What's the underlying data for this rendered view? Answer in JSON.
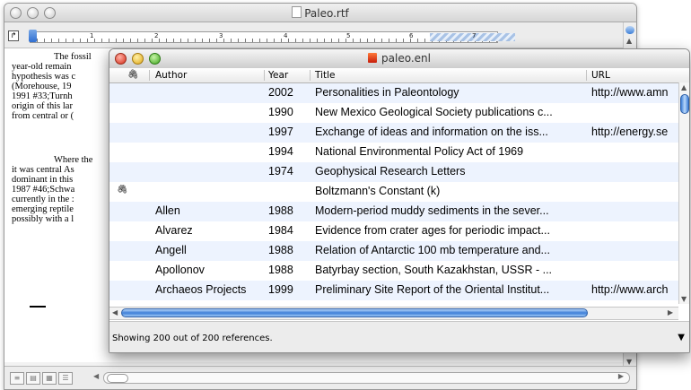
{
  "back_window": {
    "title": "Paleo.rtf",
    "ruler_numbers": [
      "1",
      "2",
      "3",
      "4",
      "5",
      "6",
      "7"
    ],
    "paragraph1": [
      "The fossil",
      "year-old remain",
      "hypothesis was c",
      "(Morehouse, 19",
      "1991 #33;Turnh",
      "origin of this lar",
      "from central or ("
    ],
    "paragraph2": [
      "Where the",
      "it was central As",
      "dominant in this",
      "1987 #46;Schwa",
      "currently in the :",
      "emerging reptile",
      "possibly with a l"
    ]
  },
  "front_window": {
    "title": "paleo.enl",
    "columns": {
      "clip": "🖇",
      "author": "Author",
      "year": "Year",
      "title": "Title",
      "url": "URL"
    },
    "rows": [
      {
        "clip": "",
        "author": "",
        "year": "2002",
        "title": "Personalities in Paleontology",
        "url": "http://www.amn"
      },
      {
        "clip": "",
        "author": "",
        "year": "1990",
        "title": "New Mexico Geological Society publications c...",
        "url": ""
      },
      {
        "clip": "",
        "author": "",
        "year": "1997",
        "title": "Exchange of ideas and information on the iss...",
        "url": "http://energy.se"
      },
      {
        "clip": "",
        "author": "",
        "year": "1994",
        "title": "National Environmental Policy Act of 1969",
        "url": ""
      },
      {
        "clip": "",
        "author": "",
        "year": "1974",
        "title": "Geophysical Research Letters",
        "url": ""
      },
      {
        "clip": "🖇",
        "author": "",
        "year": "",
        "title": "Boltzmann's Constant (k)",
        "url": ""
      },
      {
        "clip": "",
        "author": "Allen",
        "year": "1988",
        "title": "Modern-period muddy sediments in the sever...",
        "url": ""
      },
      {
        "clip": "",
        "author": "Alvarez",
        "year": "1984",
        "title": "Evidence from crater ages for periodic impact...",
        "url": ""
      },
      {
        "clip": "",
        "author": "Angell",
        "year": "1988",
        "title": "Relation of Antarctic 100 mb temperature and...",
        "url": ""
      },
      {
        "clip": "",
        "author": "Apollonov",
        "year": "1988",
        "title": "Batyrbay section, South Kazakhstan, USSR - ...",
        "url": ""
      },
      {
        "clip": "",
        "author": "Archaeos Projects",
        "year": "1999",
        "title": "Preliminary Site Report of the Oriental Institut...",
        "url": "http://www.arch"
      }
    ],
    "status": "Showing 200 out of 200 references."
  }
}
